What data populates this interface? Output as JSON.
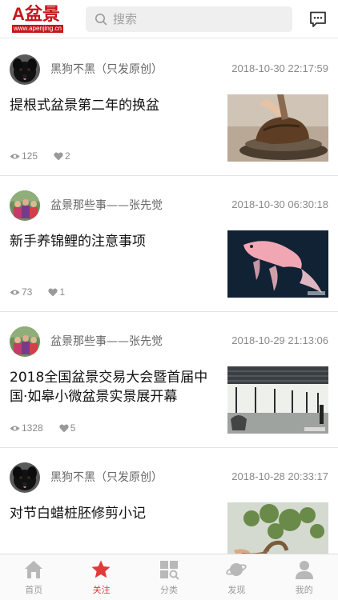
{
  "header": {
    "logo_letter": "A",
    "logo_text": "盆景",
    "logo_url": "www.apenjing.cn",
    "search_placeholder": "搜索"
  },
  "posts": [
    {
      "author": "黑狗不黑（只发原创）",
      "time": "2018-10-30 22:17:59",
      "title": "提根式盆景第二年的换盆",
      "views": "125",
      "likes": "2",
      "avatar": "black-dog",
      "image": "bonsai-root-pot"
    },
    {
      "author": "盆景那些事——张先觉",
      "time": "2018-10-30 06:30:18",
      "title": "新手养锦鲤的注意事项",
      "views": "73",
      "likes": "1",
      "avatar": "group-photo",
      "image": "pink-koi-fish"
    },
    {
      "author": "盆景那些事——张先觉",
      "time": "2018-10-29 21:13:06",
      "title": "2018全国盆景交易大会暨首届中国·如皋小微盆景实景展开幕",
      "views": "1328",
      "likes": "5",
      "avatar": "group-photo",
      "image": "exhibition-hall"
    },
    {
      "author": "黑狗不黑（只发原创）",
      "time": "2018-10-28 20:33:17",
      "title": "对节白蜡桩胚修剪小记",
      "views": "",
      "likes": "",
      "avatar": "black-dog",
      "image": "bonsai-tree-pruning"
    }
  ],
  "tabs": [
    {
      "label": "首页",
      "icon": "home-icon",
      "active": false
    },
    {
      "label": "关注",
      "icon": "star-icon",
      "active": true
    },
    {
      "label": "分类",
      "icon": "category-icon",
      "active": false
    },
    {
      "label": "发现",
      "icon": "planet-icon",
      "active": false
    },
    {
      "label": "我的",
      "icon": "profile-icon",
      "active": false
    }
  ],
  "colors": {
    "brand_red": "#c4161c",
    "active_tab": "#e03a3a",
    "muted_text": "#8a8a8a"
  }
}
